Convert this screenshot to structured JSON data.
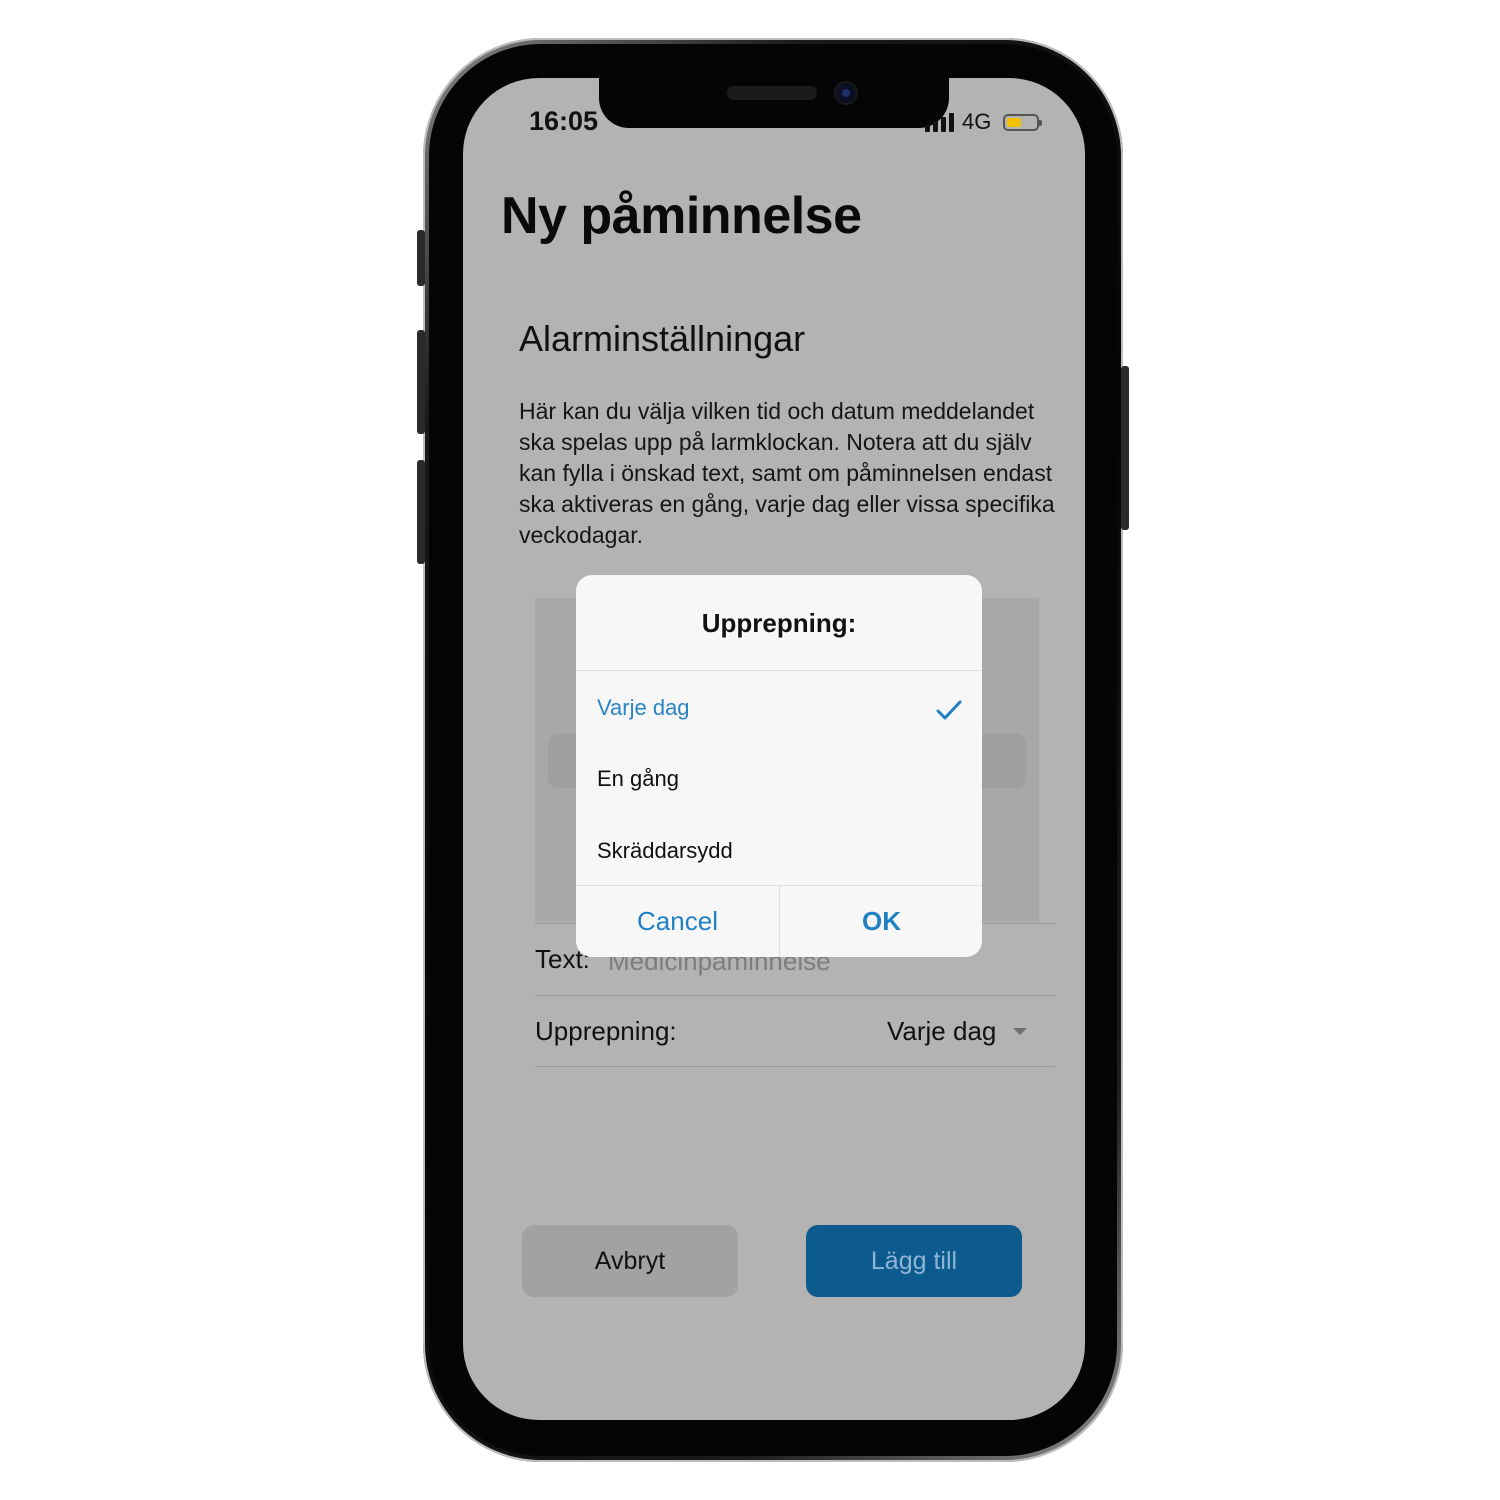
{
  "status_bar": {
    "time": "16:05",
    "network": "4G",
    "icons": [
      "signal-bars-icon",
      "battery-icon"
    ],
    "battery_color": "#f2c200"
  },
  "page": {
    "title": "Ny påminnelse",
    "section_title": "Alarminställningar",
    "description": "Här kan du välja vilken tid och datum meddelandet ska spelas upp på larmklockan. Notera att du själv kan fylla i önskad text, samt om påminnelsen endast ska aktiveras en gång, varje dag eller vissa specifika veckodagar."
  },
  "form": {
    "text_label": "Text:",
    "text_value": "Medicinpåminnelse",
    "repeat_label": "Upprepning:",
    "repeat_value": "Varje dag"
  },
  "actions": {
    "cancel_label": "Avbryt",
    "add_label": "Lägg till",
    "add_color": "#0d5a8e"
  },
  "dialog": {
    "title": "Upprepning:",
    "options": [
      {
        "label": "Varje dag",
        "selected": true
      },
      {
        "label": "En gång",
        "selected": false
      },
      {
        "label": "Skräddarsydd",
        "selected": false
      }
    ],
    "cancel_label": "Cancel",
    "ok_label": "OK",
    "accent_color": "#1f80c4"
  }
}
